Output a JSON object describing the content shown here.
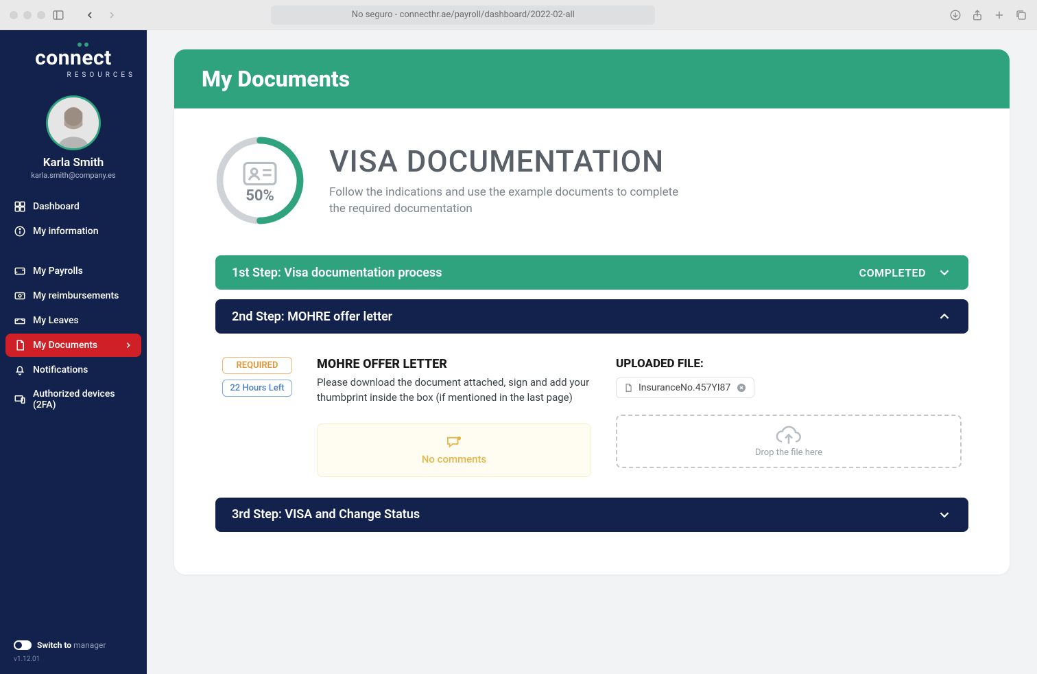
{
  "browser": {
    "address": "No seguro - connecthr.ae/payroll/dashboard/2022-02-all"
  },
  "brand": {
    "name": "connect",
    "tagline": "RESOURCES"
  },
  "user": {
    "name": "Karla Smith",
    "email": "karla.smith@company.es"
  },
  "sidebar": {
    "items": [
      {
        "label": "Dashboard"
      },
      {
        "label": "My information"
      },
      {
        "label": "My Payrolls"
      },
      {
        "label": "My reimbursements"
      },
      {
        "label": "My Leaves"
      },
      {
        "label": "My Documents"
      },
      {
        "label": "Notifications"
      },
      {
        "label": "Authorized devices (2FA)"
      }
    ],
    "switch_prefix": "Switch to",
    "switch_target": "manager",
    "version": "v1.12.01"
  },
  "page": {
    "title": "My Documents",
    "section_title": "VISA DOCUMENTATION",
    "section_desc": "Follow the indications and use the example documents to complete the required documentation",
    "progress_pct": "50%"
  },
  "steps": [
    {
      "label": "1st Step: Visa documentation process",
      "status": "COMPLETED"
    },
    {
      "label": "2nd Step: MOHRE offer letter"
    },
    {
      "label": "3rd Step: VISA and Change Status"
    }
  ],
  "detail": {
    "required_tag": "REQUIRED",
    "time_left": "22 Hours Left",
    "doc_title": "MOHRE OFFER LETTER",
    "doc_desc": "Please download the document attached, sign and add your thumbprint inside the box (if mentioned in the last page)",
    "no_comments": "No comments",
    "uploaded_label": "UPLOADED FILE:",
    "file_name": "InsuranceNo.457YI87",
    "drop_hint": "Drop the file here"
  }
}
